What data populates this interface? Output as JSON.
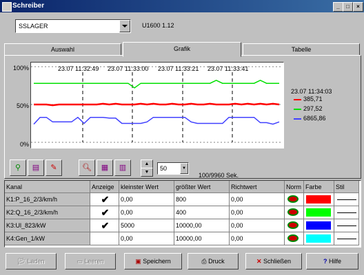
{
  "window": {
    "title": "Schreiber"
  },
  "selector": {
    "value": "SSLAGER",
    "info": "U1600 1.12"
  },
  "tabs": [
    {
      "label": "Auswahl",
      "active": false
    },
    {
      "label": "Grafik",
      "active": true
    },
    {
      "label": "Tabelle",
      "active": false
    }
  ],
  "chart_data": {
    "type": "line",
    "y_tick_labels": [
      "100%",
      "50%",
      "0%"
    ],
    "x_tick_labels": [
      "23.07 11:32:49",
      "23.07 11:33:00",
      "23.07 11:33:21",
      "23.07 11:33:41"
    ],
    "cursor_time": "23.07 11:34:03",
    "series": [
      {
        "value_label": "385,71",
        "color": "#ff0000",
        "values": [
          50,
          50,
          50,
          49,
          50,
          50,
          50,
          50,
          50,
          50,
          50,
          51,
          50,
          51,
          50,
          50,
          50,
          51,
          50,
          51,
          50,
          50,
          51,
          50,
          50,
          51,
          50,
          50,
          51,
          50,
          50,
          50,
          51,
          50,
          51,
          50,
          51,
          50,
          51,
          50
        ]
      },
      {
        "value_label": "297,52",
        "color": "#00e000",
        "values": [
          78,
          78,
          78,
          78,
          78,
          78,
          78,
          78,
          78,
          78,
          78,
          78,
          78,
          78,
          78,
          78,
          72,
          78,
          78,
          78,
          78,
          78,
          78,
          78,
          78,
          78,
          78,
          78,
          78,
          82,
          78,
          78,
          78,
          78,
          78,
          78,
          82,
          78,
          78,
          78
        ]
      },
      {
        "value_label": "6865,86",
        "color": "#4040ff",
        "values": [
          24,
          33,
          33,
          27,
          27,
          27,
          27,
          33,
          25,
          33,
          33,
          33,
          32,
          32,
          25,
          25,
          25,
          25,
          27,
          33,
          33,
          33,
          33,
          33,
          33,
          27,
          25,
          25,
          25,
          25,
          25,
          33,
          33,
          33,
          33,
          33,
          26,
          26,
          24,
          27
        ]
      }
    ]
  },
  "toolbar": {
    "interval_value": "50",
    "scan_text": "100/9960 Sek."
  },
  "table": {
    "headers": [
      "Kanal",
      "Anzeige",
      "kleinster Wert",
      "größter Wert",
      "Richtwert",
      "Norm",
      "Farbe",
      "Stil"
    ],
    "rows": [
      {
        "kanal": "K1:P_16_2/3/km/h",
        "anzeige": "✔",
        "min": "0,00",
        "max": "800",
        "richt": "0,00",
        "color": "#ff0000"
      },
      {
        "kanal": "K2:Q_16_2/3/km/h",
        "anzeige": "✔",
        "min": "0,00",
        "max": "400",
        "richt": "0,00",
        "color": "#00ff00"
      },
      {
        "kanal": "K3:Ul_823/kW",
        "anzeige": "✔",
        "min": "5000",
        "max": "10000,00",
        "richt": "0,00",
        "color": "#0000ff"
      },
      {
        "kanal": "K4:Gen_1/kW",
        "anzeige": "",
        "min": "0,00",
        "max": "10000,00",
        "richt": "0,00",
        "color": "#00ffff"
      }
    ]
  },
  "buttons": {
    "laden": "Laden",
    "loeschen": "Leeren",
    "speichern": "Speichern",
    "drucken": "Druck",
    "schliessen": "Schließen",
    "hilfe": "Hilfe"
  }
}
